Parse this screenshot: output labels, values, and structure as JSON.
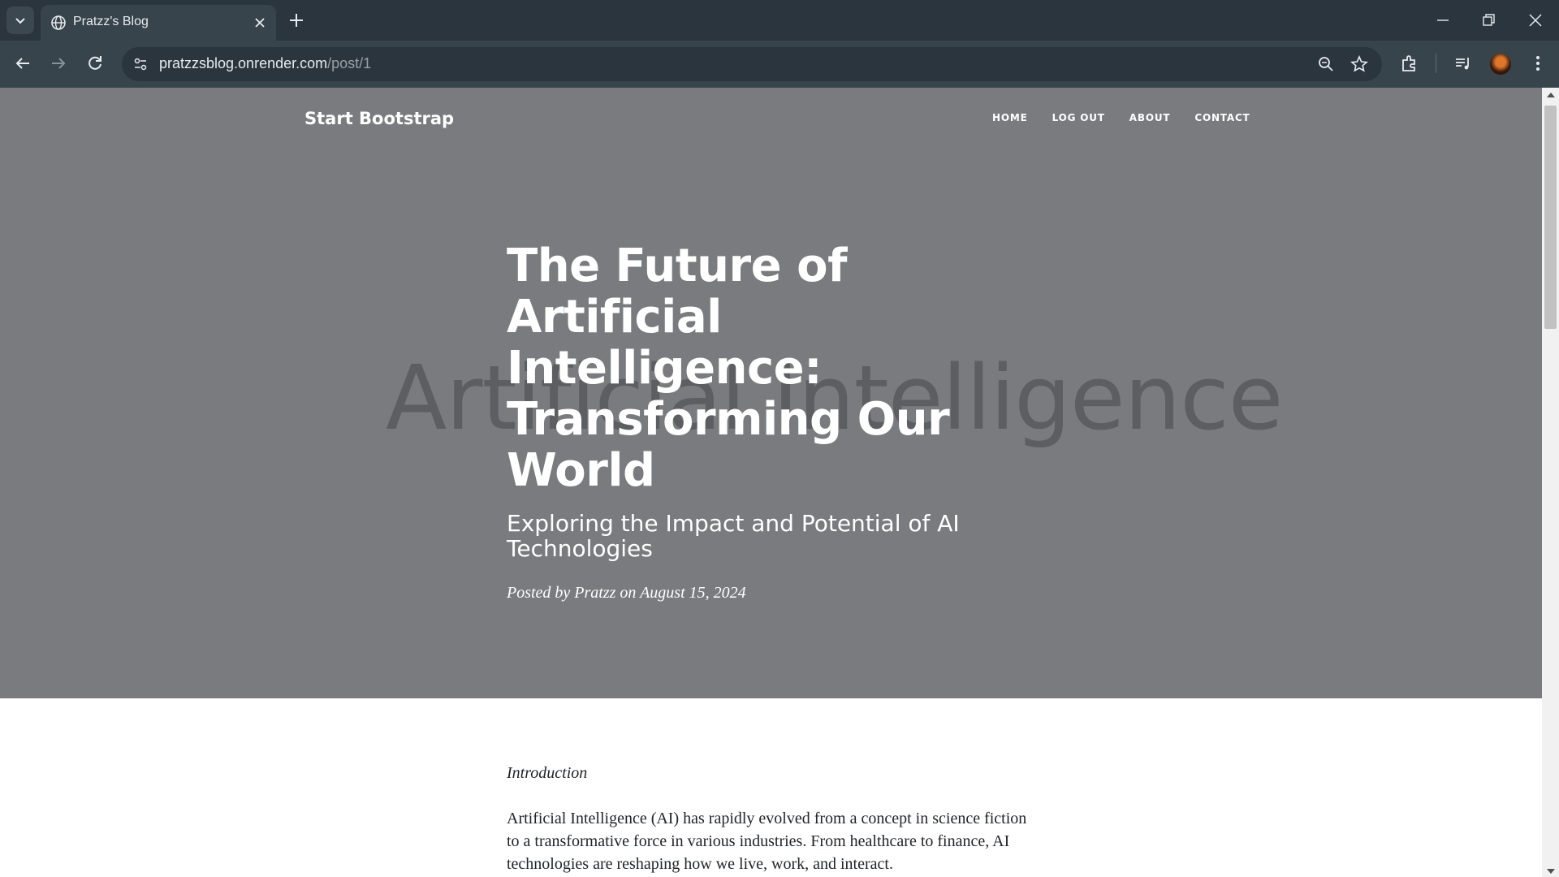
{
  "browser": {
    "tab_title": "Pratzz's Blog",
    "url_host": "pratzzsblog.onrender.com",
    "url_path": "/post/1"
  },
  "navbar": {
    "brand": "Start Bootstrap",
    "links": [
      "HOME",
      "LOG OUT",
      "ABOUT",
      "CONTACT"
    ]
  },
  "hero": {
    "watermark": "Artificial Intelligence",
    "title": "The Future of Artificial Intelligence: Transforming Our World",
    "subtitle": "Exploring the Impact and Potential of AI Technologies",
    "meta": "Posted by Pratzz on August 15, 2024"
  },
  "article": {
    "intro_heading": "Introduction",
    "paragraph_1": "Artificial Intelligence (AI) has rapidly evolved from a concept in science fiction to a transformative force in various industries. From healthcare to finance, AI technologies are reshaping how we live, work, and interact."
  },
  "colors": {
    "chrome_dark": "#2a353d",
    "chrome_tab": "#37444c",
    "hero_bg": "#7a7b7e",
    "text_body": "#212529"
  }
}
